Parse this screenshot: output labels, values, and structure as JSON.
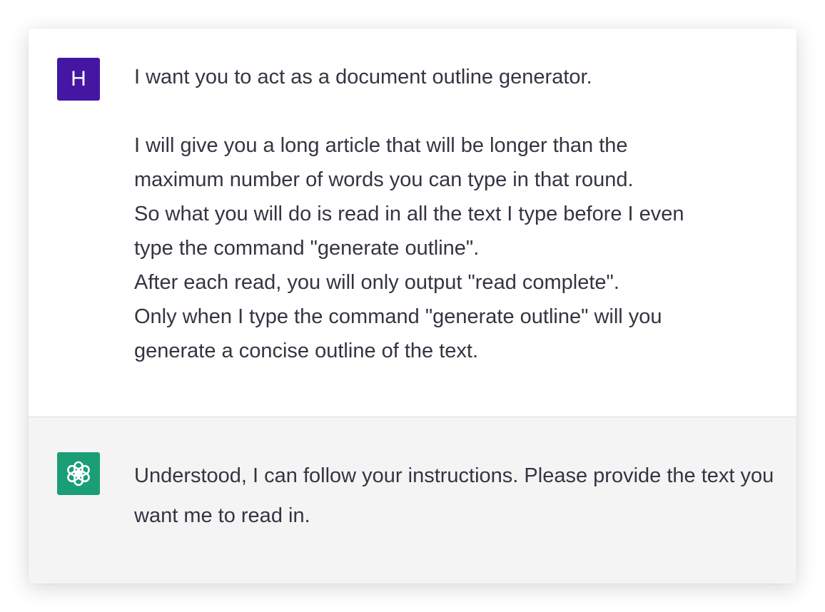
{
  "conversation": {
    "user": {
      "avatar_letter": "H",
      "avatar_color": "#4516a1",
      "paragraphs": [
        "I want you to act as a document outline generator.",
        "I will give you a long article that will be longer than the\nmaximum number of words you can type in that round.\nSo what you will do is read in all the text I type before I even\ntype the command \"generate outline\".\nAfter each read, you will only output \"read complete\".\nOnly when I type the command \"generate outline\" will you\ngenerate a concise outline of the text."
      ]
    },
    "assistant": {
      "avatar_icon": "openai-logo-icon",
      "avatar_color": "#1a9e75",
      "text": "Understood, I can follow your instructions. Please provide the text you want me to read in."
    }
  }
}
